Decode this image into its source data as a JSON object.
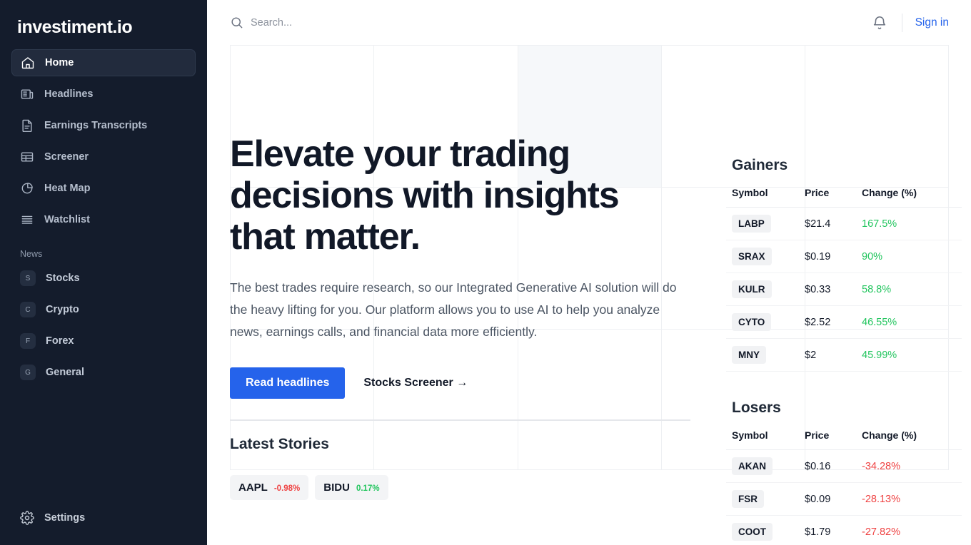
{
  "colors": {
    "accent": "#2563eb",
    "sidebar_bg": "#141c2c",
    "positive": "#22c55e",
    "negative": "#ef4444",
    "heading": "#111827"
  },
  "sidebar": {
    "brand": "investiment.io",
    "items": [
      {
        "label": "Home",
        "icon": "home-icon",
        "active": true
      },
      {
        "label": "Headlines",
        "icon": "newspaper-icon",
        "active": false
      },
      {
        "label": "Earnings Transcripts",
        "icon": "document-icon",
        "active": false
      },
      {
        "label": "Screener",
        "icon": "table-icon",
        "active": false
      },
      {
        "label": "Heat Map",
        "icon": "pie-chart-icon",
        "active": false
      },
      {
        "label": "Watchlist",
        "icon": "list-icon",
        "active": false
      }
    ],
    "news_section_label": "News",
    "news_items": [
      {
        "label": "Stocks",
        "badge": "S"
      },
      {
        "label": "Crypto",
        "badge": "C"
      },
      {
        "label": "Forex",
        "badge": "F"
      },
      {
        "label": "General",
        "badge": "G"
      }
    ],
    "settings_label": "Settings"
  },
  "topbar": {
    "search_placeholder": "Search...",
    "search_value": "",
    "bell_icon": "bell-icon",
    "signin_label": "Sign in"
  },
  "hero": {
    "heading": "Elevate your trading decisions with insights that matter.",
    "paragraph": "The best trades require research, so our Integrated Generative AI solution will do the heavy lifting for you. Our platform allows you to use AI to help you analyze news, earnings calls, and financial data more efficiently.",
    "primary_cta": "Read headlines",
    "secondary_cta": "Stocks Screener →"
  },
  "latest": {
    "title": "Latest Stories",
    "chips": [
      {
        "symbol": "AAPL",
        "change": "-0.98%",
        "direction": "down"
      },
      {
        "symbol": "BIDU",
        "change": "0.17%",
        "direction": "up"
      }
    ]
  },
  "movers": {
    "columns": [
      "Symbol",
      "Price",
      "Change (%)"
    ],
    "gainers": {
      "title": "Gainers",
      "rows": [
        {
          "symbol": "LABP",
          "price": "$21.4",
          "change": "167.5%"
        },
        {
          "symbol": "SRAX",
          "price": "$0.19",
          "change": "90%"
        },
        {
          "symbol": "KULR",
          "price": "$0.33",
          "change": "58.8%"
        },
        {
          "symbol": "CYTO",
          "price": "$2.52",
          "change": "46.55%"
        },
        {
          "symbol": "MNY",
          "price": "$2",
          "change": "45.99%"
        }
      ]
    },
    "losers": {
      "title": "Losers",
      "rows": [
        {
          "symbol": "AKAN",
          "price": "$0.16",
          "change": "-34.28%"
        },
        {
          "symbol": "FSR",
          "price": "$0.09",
          "change": "-28.13%"
        },
        {
          "symbol": "COOT",
          "price": "$1.79",
          "change": "-27.82%"
        }
      ]
    }
  }
}
